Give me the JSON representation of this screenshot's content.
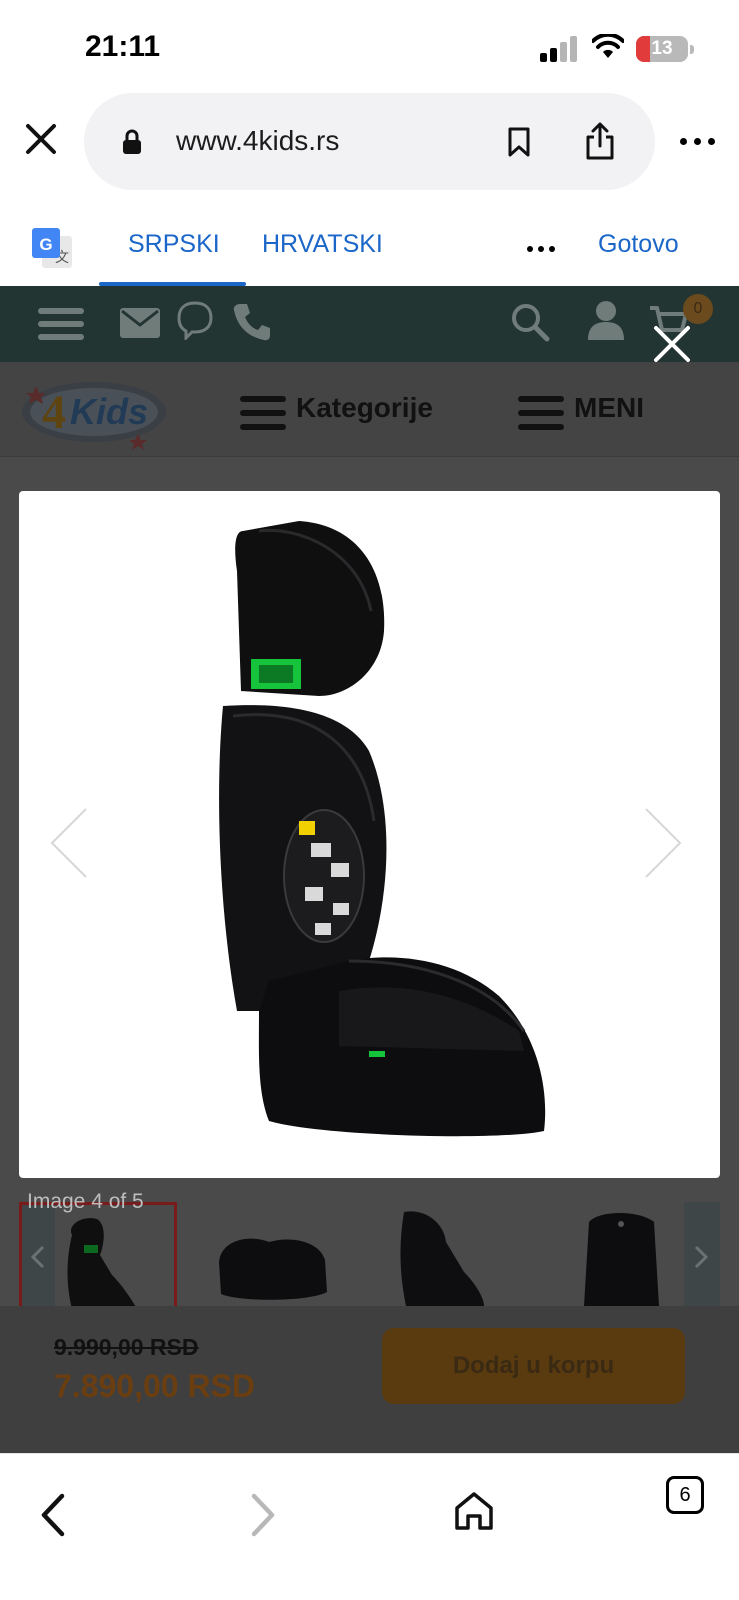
{
  "status_bar": {
    "time": "21:11",
    "battery": "13"
  },
  "browser": {
    "url": "www.4kids.rs",
    "translate": {
      "languages": [
        "SRPSKI",
        "HRVATSKI"
      ],
      "active_language": "SRPSKI",
      "done_label": "Gotovo"
    },
    "tabs_count": "6"
  },
  "site": {
    "cart_count": "0",
    "categories_label": "Kategorije",
    "menu_label": "MENI",
    "logo_text": "4Kids"
  },
  "gallery": {
    "caption": "Image 4 of 5",
    "current": 4,
    "total": 5
  },
  "product": {
    "old_price": "9.990,00 RSD",
    "price": "7.890,00 RSD",
    "add_to_cart_label": "Dodaj u korpu"
  },
  "colors": {
    "link_blue": "#1a66c9",
    "header_dark": "#233533",
    "accent_orange": "#6a3e10"
  }
}
